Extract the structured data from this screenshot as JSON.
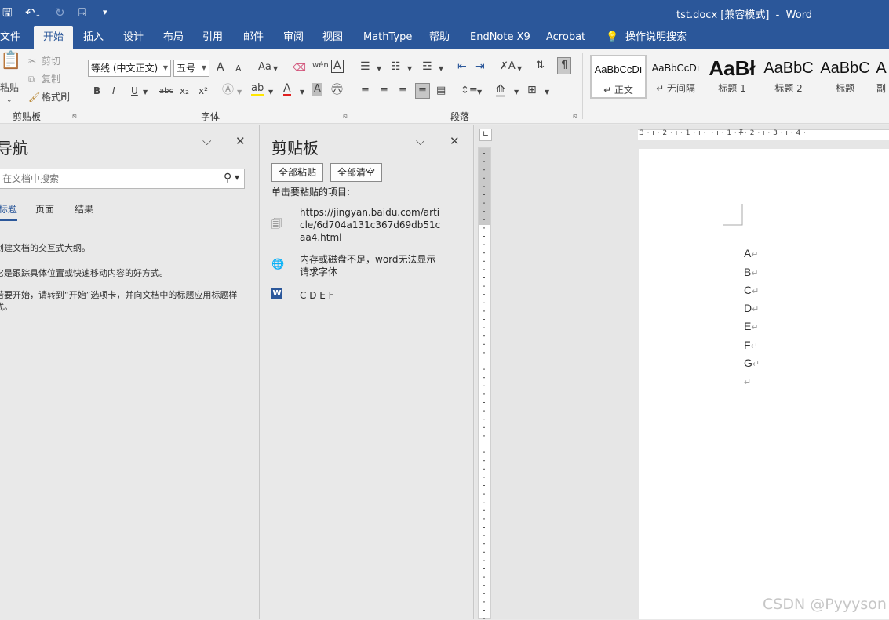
{
  "titlebar": {
    "title": "tst.docx [兼容模式]  -  Word"
  },
  "tabs": [
    "文件",
    "开始",
    "插入",
    "设计",
    "布局",
    "引用",
    "邮件",
    "审阅",
    "视图",
    "MathType",
    "帮助",
    "EndNote X9",
    "Acrobat",
    "操作说明搜索"
  ],
  "active_tab": "开始",
  "ribbon": {
    "clipboard": {
      "paste": "粘贴",
      "cut": "剪切",
      "copy": "复制",
      "format_painter": "格式刷",
      "label": "剪贴板"
    },
    "font": {
      "name": "等线 (中文正文)",
      "size": "五号",
      "label": "字体",
      "bold": "B",
      "italic": "I",
      "underline": "U",
      "strike": "abc",
      "subscript": "x₂",
      "superscript": "x²",
      "grow": "A",
      "shrink": "A",
      "case": "Aa",
      "phonetic": "wén",
      "border": "A"
    },
    "paragraph": {
      "label": "段落"
    },
    "styles": [
      {
        "preview": "AaBbCcDı",
        "name": "↵ 正文"
      },
      {
        "preview": "AaBbCcDı",
        "name": "↵ 无间隔"
      },
      {
        "preview": "AaBł",
        "name": "标题 1"
      },
      {
        "preview": "AaBbC",
        "name": "标题 2"
      },
      {
        "preview": "AaBbC",
        "name": "标题"
      },
      {
        "preview": "A",
        "name": "副"
      }
    ]
  },
  "navigation": {
    "title": "导航",
    "search_placeholder": "在文档中搜索",
    "tabs": [
      "标题",
      "页面",
      "结果"
    ],
    "line1": "创建文档的交互式大纲。",
    "line2": "它是跟踪具体位置或快速移动内容的好方式。",
    "line3": "若要开始，请转到“开始”选项卡，并向文档中的标题应用标题样式。"
  },
  "clipboard_pane": {
    "title": "剪贴板",
    "paste_all": "全部粘贴",
    "clear_all": "全部清空",
    "hint": "单击要粘贴的项目:",
    "items": [
      {
        "text": "https://jingyan.baidu.com/article/6d704a131c367d69db51caa4.html"
      },
      {
        "text": "内存或磁盘不足，word无法显示请求字体"
      },
      {
        "text": "C D E F"
      }
    ]
  },
  "document": {
    "paragraphs": [
      "A",
      "B",
      "C",
      "D",
      "E",
      "F",
      "G",
      ""
    ],
    "pilcrow": "↵"
  },
  "ruler": {
    "h_labels": "3 · ı · 2 · ı · 1 · ı ·  · ı · 1 · ı · 2 · ı · 3 · ı · 4 ·"
  },
  "watermark": "CSDN @Pyyyson"
}
